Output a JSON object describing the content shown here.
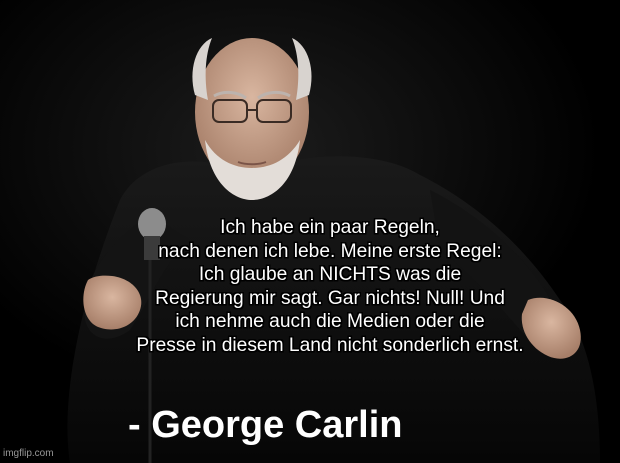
{
  "meme": {
    "quote": "Ich habe ein paar Regeln,\nnach denen ich lebe. Meine erste Regel:\nIch glaube an NICHTS was die\nRegierung mir sagt. Gar nichts! Null! Und\nich nehme auch die Medien oder die\nPresse in diesem Land nicht sonderlich ernst.",
    "attribution": "- George Carlin",
    "watermark": "imgflip.com"
  },
  "colors": {
    "background": "#000000",
    "text": "#ffffff",
    "jacket": "#101010",
    "skin": "#c9a690",
    "hair": "#d8d3cf",
    "microphone": "#8c8c8c"
  },
  "icons": {
    "microphone": "microphone-icon"
  }
}
